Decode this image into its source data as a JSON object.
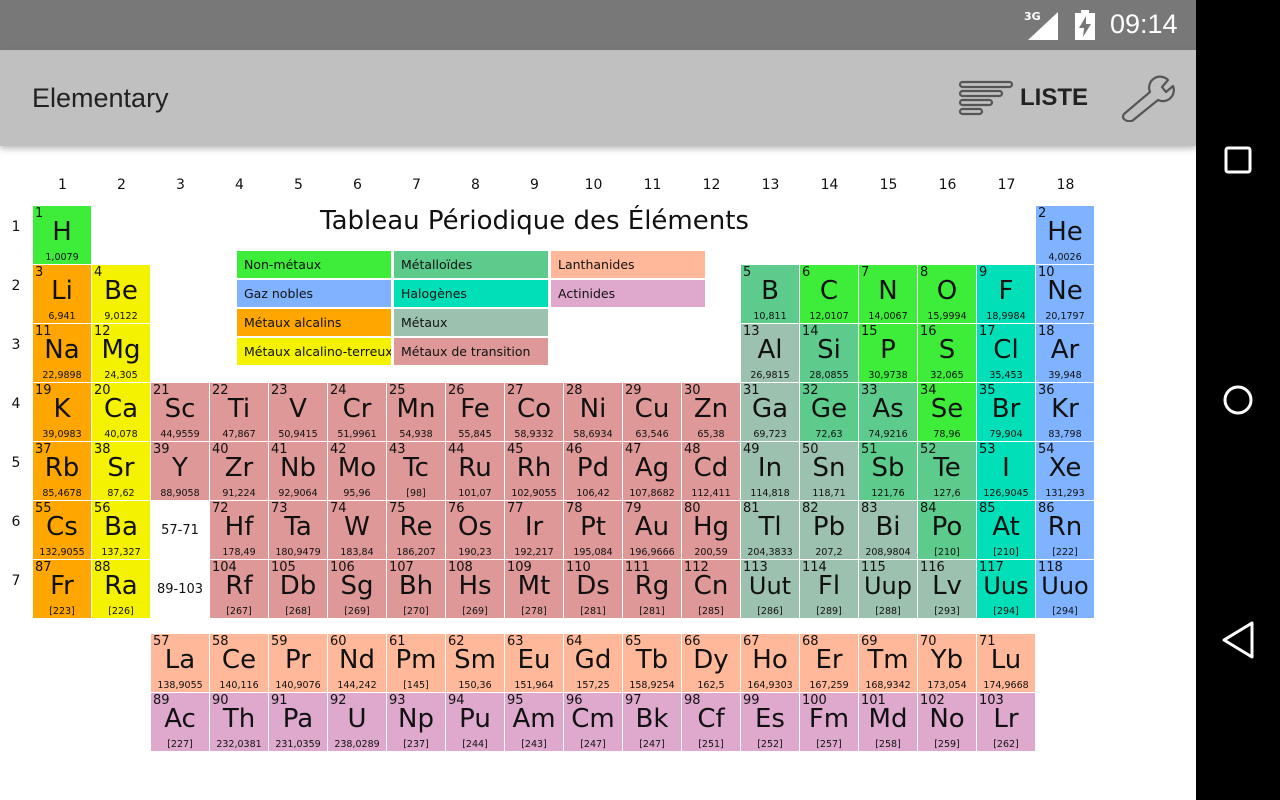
{
  "status_bar": {
    "network": "3G",
    "time": "09:14"
  },
  "app_bar": {
    "title": "Elementary",
    "list_label": "LISTE"
  },
  "table_title": "Tableau Périodique des Éléments",
  "colors": {
    "nonmetal": "#3ded3a",
    "noble": "#7fb2ff",
    "alkali": "#ffa600",
    "alkaline": "#f5f200",
    "metalloid": "#5ccb8c",
    "halogen": "#00dfb8",
    "metal": "#9cc1ae",
    "transition": "#de9898",
    "lanthanide": "#ffb899",
    "actinide": "#dea9cc",
    "appbar": "#c0c0c0",
    "statusbar": "#787878"
  },
  "group_labels": [
    "1",
    "2",
    "3",
    "4",
    "5",
    "6",
    "7",
    "8",
    "9",
    "10",
    "11",
    "12",
    "13",
    "14",
    "15",
    "16",
    "17",
    "18"
  ],
  "period_labels": [
    "1",
    "2",
    "3",
    "4",
    "5",
    "6",
    "7"
  ],
  "legend": [
    {
      "label": "Non-métaux",
      "cat": "nonmetal"
    },
    {
      "label": "Gaz nobles",
      "cat": "noble"
    },
    {
      "label": "Métaux alcalins",
      "cat": "alkali"
    },
    {
      "label": "Métaux alcalino-terreux",
      "cat": "alkaline"
    },
    {
      "label": "Métalloïdes",
      "cat": "metalloid"
    },
    {
      "label": "Halogènes",
      "cat": "halogen"
    },
    {
      "label": "Métaux",
      "cat": "metal"
    },
    {
      "label": "Métaux de transition",
      "cat": "transition"
    },
    {
      "label": "Lanthanides",
      "cat": "lanthanide"
    },
    {
      "label": "Actinides",
      "cat": "actinide"
    }
  ],
  "placeholders": [
    {
      "label": "57-71",
      "row": 6,
      "col": 3
    },
    {
      "label": "89-103",
      "row": 7,
      "col": 3
    }
  ],
  "elements": [
    {
      "n": "1",
      "s": "H",
      "m": "1,0079",
      "cat": "nonmetal",
      "row": 1,
      "col": 1
    },
    {
      "n": "2",
      "s": "He",
      "m": "4,0026",
      "cat": "noble",
      "row": 1,
      "col": 18
    },
    {
      "n": "3",
      "s": "Li",
      "m": "6,941",
      "cat": "alkali",
      "row": 2,
      "col": 1
    },
    {
      "n": "4",
      "s": "Be",
      "m": "9,0122",
      "cat": "alkaline",
      "row": 2,
      "col": 2
    },
    {
      "n": "5",
      "s": "B",
      "m": "10,811",
      "cat": "metalloid",
      "row": 2,
      "col": 13
    },
    {
      "n": "6",
      "s": "C",
      "m": "12,0107",
      "cat": "nonmetal",
      "row": 2,
      "col": 14
    },
    {
      "n": "7",
      "s": "N",
      "m": "14,0067",
      "cat": "nonmetal",
      "row": 2,
      "col": 15
    },
    {
      "n": "8",
      "s": "O",
      "m": "15,9994",
      "cat": "nonmetal",
      "row": 2,
      "col": 16
    },
    {
      "n": "9",
      "s": "F",
      "m": "18,9984",
      "cat": "halogen",
      "row": 2,
      "col": 17
    },
    {
      "n": "10",
      "s": "Ne",
      "m": "20,1797",
      "cat": "noble",
      "row": 2,
      "col": 18
    },
    {
      "n": "11",
      "s": "Na",
      "m": "22,9898",
      "cat": "alkali",
      "row": 3,
      "col": 1
    },
    {
      "n": "12",
      "s": "Mg",
      "m": "24,305",
      "cat": "alkaline",
      "row": 3,
      "col": 2
    },
    {
      "n": "13",
      "s": "Al",
      "m": "26,9815",
      "cat": "metal",
      "row": 3,
      "col": 13
    },
    {
      "n": "14",
      "s": "Si",
      "m": "28,0855",
      "cat": "metalloid",
      "row": 3,
      "col": 14
    },
    {
      "n": "15",
      "s": "P",
      "m": "30,9738",
      "cat": "nonmetal",
      "row": 3,
      "col": 15
    },
    {
      "n": "16",
      "s": "S",
      "m": "32,065",
      "cat": "nonmetal",
      "row": 3,
      "col": 16
    },
    {
      "n": "17",
      "s": "Cl",
      "m": "35,453",
      "cat": "halogen",
      "row": 3,
      "col": 17
    },
    {
      "n": "18",
      "s": "Ar",
      "m": "39,948",
      "cat": "noble",
      "row": 3,
      "col": 18
    },
    {
      "n": "19",
      "s": "K",
      "m": "39,0983",
      "cat": "alkali",
      "row": 4,
      "col": 1
    },
    {
      "n": "20",
      "s": "Ca",
      "m": "40,078",
      "cat": "alkaline",
      "row": 4,
      "col": 2
    },
    {
      "n": "21",
      "s": "Sc",
      "m": "44,9559",
      "cat": "transition",
      "row": 4,
      "col": 3
    },
    {
      "n": "22",
      "s": "Ti",
      "m": "47,867",
      "cat": "transition",
      "row": 4,
      "col": 4
    },
    {
      "n": "23",
      "s": "V",
      "m": "50,9415",
      "cat": "transition",
      "row": 4,
      "col": 5
    },
    {
      "n": "24",
      "s": "Cr",
      "m": "51,9961",
      "cat": "transition",
      "row": 4,
      "col": 6
    },
    {
      "n": "25",
      "s": "Mn",
      "m": "54,938",
      "cat": "transition",
      "row": 4,
      "col": 7
    },
    {
      "n": "26",
      "s": "Fe",
      "m": "55,845",
      "cat": "transition",
      "row": 4,
      "col": 8
    },
    {
      "n": "27",
      "s": "Co",
      "m": "58,9332",
      "cat": "transition",
      "row": 4,
      "col": 9
    },
    {
      "n": "28",
      "s": "Ni",
      "m": "58,6934",
      "cat": "transition",
      "row": 4,
      "col": 10
    },
    {
      "n": "29",
      "s": "Cu",
      "m": "63,546",
      "cat": "transition",
      "row": 4,
      "col": 11
    },
    {
      "n": "30",
      "s": "Zn",
      "m": "65,38",
      "cat": "transition",
      "row": 4,
      "col": 12
    },
    {
      "n": "31",
      "s": "Ga",
      "m": "69,723",
      "cat": "metal",
      "row": 4,
      "col": 13
    },
    {
      "n": "32",
      "s": "Ge",
      "m": "72,63",
      "cat": "metalloid",
      "row": 4,
      "col": 14
    },
    {
      "n": "33",
      "s": "As",
      "m": "74,9216",
      "cat": "metalloid",
      "row": 4,
      "col": 15
    },
    {
      "n": "34",
      "s": "Se",
      "m": "78,96",
      "cat": "nonmetal",
      "row": 4,
      "col": 16
    },
    {
      "n": "35",
      "s": "Br",
      "m": "79,904",
      "cat": "halogen",
      "row": 4,
      "col": 17
    },
    {
      "n": "36",
      "s": "Kr",
      "m": "83,798",
      "cat": "noble",
      "row": 4,
      "col": 18
    },
    {
      "n": "37",
      "s": "Rb",
      "m": "85,4678",
      "cat": "alkali",
      "row": 5,
      "col": 1
    },
    {
      "n": "38",
      "s": "Sr",
      "m": "87,62",
      "cat": "alkaline",
      "row": 5,
      "col": 2
    },
    {
      "n": "39",
      "s": "Y",
      "m": "88,9058",
      "cat": "transition",
      "row": 5,
      "col": 3
    },
    {
      "n": "40",
      "s": "Zr",
      "m": "91,224",
      "cat": "transition",
      "row": 5,
      "col": 4
    },
    {
      "n": "41",
      "s": "Nb",
      "m": "92,9064",
      "cat": "transition",
      "row": 5,
      "col": 5
    },
    {
      "n": "42",
      "s": "Mo",
      "m": "95,96",
      "cat": "transition",
      "row": 5,
      "col": 6
    },
    {
      "n": "43",
      "s": "Tc",
      "m": "[98]",
      "cat": "transition",
      "row": 5,
      "col": 7
    },
    {
      "n": "44",
      "s": "Ru",
      "m": "101,07",
      "cat": "transition",
      "row": 5,
      "col": 8
    },
    {
      "n": "45",
      "s": "Rh",
      "m": "102,9055",
      "cat": "transition",
      "row": 5,
      "col": 9
    },
    {
      "n": "46",
      "s": "Pd",
      "m": "106,42",
      "cat": "transition",
      "row": 5,
      "col": 10
    },
    {
      "n": "47",
      "s": "Ag",
      "m": "107,8682",
      "cat": "transition",
      "row": 5,
      "col": 11
    },
    {
      "n": "48",
      "s": "Cd",
      "m": "112,411",
      "cat": "transition",
      "row": 5,
      "col": 12
    },
    {
      "n": "49",
      "s": "In",
      "m": "114,818",
      "cat": "metal",
      "row": 5,
      "col": 13
    },
    {
      "n": "50",
      "s": "Sn",
      "m": "118,71",
      "cat": "metal",
      "row": 5,
      "col": 14
    },
    {
      "n": "51",
      "s": "Sb",
      "m": "121,76",
      "cat": "metalloid",
      "row": 5,
      "col": 15
    },
    {
      "n": "52",
      "s": "Te",
      "m": "127,6",
      "cat": "metalloid",
      "row": 5,
      "col": 16
    },
    {
      "n": "53",
      "s": "I",
      "m": "126,9045",
      "cat": "halogen",
      "row": 5,
      "col": 17
    },
    {
      "n": "54",
      "s": "Xe",
      "m": "131,293",
      "cat": "noble",
      "row": 5,
      "col": 18
    },
    {
      "n": "55",
      "s": "Cs",
      "m": "132,9055",
      "cat": "alkali",
      "row": 6,
      "col": 1
    },
    {
      "n": "56",
      "s": "Ba",
      "m": "137,327",
      "cat": "alkaline",
      "row": 6,
      "col": 2
    },
    {
      "n": "72",
      "s": "Hf",
      "m": "178,49",
      "cat": "transition",
      "row": 6,
      "col": 4
    },
    {
      "n": "73",
      "s": "Ta",
      "m": "180,9479",
      "cat": "transition",
      "row": 6,
      "col": 5
    },
    {
      "n": "74",
      "s": "W",
      "m": "183,84",
      "cat": "transition",
      "row": 6,
      "col": 6
    },
    {
      "n": "75",
      "s": "Re",
      "m": "186,207",
      "cat": "transition",
      "row": 6,
      "col": 7
    },
    {
      "n": "76",
      "s": "Os",
      "m": "190,23",
      "cat": "transition",
      "row": 6,
      "col": 8
    },
    {
      "n": "77",
      "s": "Ir",
      "m": "192,217",
      "cat": "transition",
      "row": 6,
      "col": 9
    },
    {
      "n": "78",
      "s": "Pt",
      "m": "195,084",
      "cat": "transition",
      "row": 6,
      "col": 10
    },
    {
      "n": "79",
      "s": "Au",
      "m": "196,9666",
      "cat": "transition",
      "row": 6,
      "col": 11
    },
    {
      "n": "80",
      "s": "Hg",
      "m": "200,59",
      "cat": "transition",
      "row": 6,
      "col": 12
    },
    {
      "n": "81",
      "s": "Tl",
      "m": "204,3833",
      "cat": "metal",
      "row": 6,
      "col": 13
    },
    {
      "n": "82",
      "s": "Pb",
      "m": "207,2",
      "cat": "metal",
      "row": 6,
      "col": 14
    },
    {
      "n": "83",
      "s": "Bi",
      "m": "208,9804",
      "cat": "metal",
      "row": 6,
      "col": 15
    },
    {
      "n": "84",
      "s": "Po",
      "m": "[210]",
      "cat": "metalloid",
      "row": 6,
      "col": 16
    },
    {
      "n": "85",
      "s": "At",
      "m": "[210]",
      "cat": "halogen",
      "row": 6,
      "col": 17
    },
    {
      "n": "86",
      "s": "Rn",
      "m": "[222]",
      "cat": "noble",
      "row": 6,
      "col": 18
    },
    {
      "n": "87",
      "s": "Fr",
      "m": "[223]",
      "cat": "alkali",
      "row": 7,
      "col": 1
    },
    {
      "n": "88",
      "s": "Ra",
      "m": "[226]",
      "cat": "alkaline",
      "row": 7,
      "col": 2
    },
    {
      "n": "104",
      "s": "Rf",
      "m": "[267]",
      "cat": "transition",
      "row": 7,
      "col": 4
    },
    {
      "n": "105",
      "s": "Db",
      "m": "[268]",
      "cat": "transition",
      "row": 7,
      "col": 5
    },
    {
      "n": "106",
      "s": "Sg",
      "m": "[269]",
      "cat": "transition",
      "row": 7,
      "col": 6
    },
    {
      "n": "107",
      "s": "Bh",
      "m": "[270]",
      "cat": "transition",
      "row": 7,
      "col": 7
    },
    {
      "n": "108",
      "s": "Hs",
      "m": "[269]",
      "cat": "transition",
      "row": 7,
      "col": 8
    },
    {
      "n": "109",
      "s": "Mt",
      "m": "[278]",
      "cat": "transition",
      "row": 7,
      "col": 9
    },
    {
      "n": "110",
      "s": "Ds",
      "m": "[281]",
      "cat": "transition",
      "row": 7,
      "col": 10
    },
    {
      "n": "111",
      "s": "Rg",
      "m": "[281]",
      "cat": "transition",
      "row": 7,
      "col": 11
    },
    {
      "n": "112",
      "s": "Cn",
      "m": "[285]",
      "cat": "transition",
      "row": 7,
      "col": 12
    },
    {
      "n": "113",
      "s": "Uut",
      "m": "[286]",
      "cat": "metal",
      "row": 7,
      "col": 13
    },
    {
      "n": "114",
      "s": "Fl",
      "m": "[289]",
      "cat": "metal",
      "row": 7,
      "col": 14
    },
    {
      "n": "115",
      "s": "Uup",
      "m": "[288]",
      "cat": "metal",
      "row": 7,
      "col": 15
    },
    {
      "n": "116",
      "s": "Lv",
      "m": "[293]",
      "cat": "metal",
      "row": 7,
      "col": 16
    },
    {
      "n": "117",
      "s": "Uus",
      "m": "[294]",
      "cat": "halogen",
      "row": 7,
      "col": 17
    },
    {
      "n": "118",
      "s": "Uuo",
      "m": "[294]",
      "cat": "noble",
      "row": 7,
      "col": 18
    },
    {
      "n": "57",
      "s": "La",
      "m": "138,9055",
      "cat": "lanthanide",
      "row": 9,
      "col": 3
    },
    {
      "n": "58",
      "s": "Ce",
      "m": "140,116",
      "cat": "lanthanide",
      "row": 9,
      "col": 4
    },
    {
      "n": "59",
      "s": "Pr",
      "m": "140,9076",
      "cat": "lanthanide",
      "row": 9,
      "col": 5
    },
    {
      "n": "60",
      "s": "Nd",
      "m": "144,242",
      "cat": "lanthanide",
      "row": 9,
      "col": 6
    },
    {
      "n": "61",
      "s": "Pm",
      "m": "[145]",
      "cat": "lanthanide",
      "row": 9,
      "col": 7
    },
    {
      "n": "62",
      "s": "Sm",
      "m": "150,36",
      "cat": "lanthanide",
      "row": 9,
      "col": 8
    },
    {
      "n": "63",
      "s": "Eu",
      "m": "151,964",
      "cat": "lanthanide",
      "row": 9,
      "col": 9
    },
    {
      "n": "64",
      "s": "Gd",
      "m": "157,25",
      "cat": "lanthanide",
      "row": 9,
      "col": 10
    },
    {
      "n": "65",
      "s": "Tb",
      "m": "158,9254",
      "cat": "lanthanide",
      "row": 9,
      "col": 11
    },
    {
      "n": "66",
      "s": "Dy",
      "m": "162,5",
      "cat": "lanthanide",
      "row": 9,
      "col": 12
    },
    {
      "n": "67",
      "s": "Ho",
      "m": "164,9303",
      "cat": "lanthanide",
      "row": 9,
      "col": 13
    },
    {
      "n": "68",
      "s": "Er",
      "m": "167,259",
      "cat": "lanthanide",
      "row": 9,
      "col": 14
    },
    {
      "n": "69",
      "s": "Tm",
      "m": "168,9342",
      "cat": "lanthanide",
      "row": 9,
      "col": 15
    },
    {
      "n": "70",
      "s": "Yb",
      "m": "173,054",
      "cat": "lanthanide",
      "row": 9,
      "col": 16
    },
    {
      "n": "71",
      "s": "Lu",
      "m": "174,9668",
      "cat": "lanthanide",
      "row": 9,
      "col": 17
    },
    {
      "n": "89",
      "s": "Ac",
      "m": "[227]",
      "cat": "actinide",
      "row": 10,
      "col": 3
    },
    {
      "n": "90",
      "s": "Th",
      "m": "232,0381",
      "cat": "actinide",
      "row": 10,
      "col": 4
    },
    {
      "n": "91",
      "s": "Pa",
      "m": "231,0359",
      "cat": "actinide",
      "row": 10,
      "col": 5
    },
    {
      "n": "92",
      "s": "U",
      "m": "238,0289",
      "cat": "actinide",
      "row": 10,
      "col": 6
    },
    {
      "n": "93",
      "s": "Np",
      "m": "[237]",
      "cat": "actinide",
      "row": 10,
      "col": 7
    },
    {
      "n": "94",
      "s": "Pu",
      "m": "[244]",
      "cat": "actinide",
      "row": 10,
      "col": 8
    },
    {
      "n": "95",
      "s": "Am",
      "m": "[243]",
      "cat": "actinide",
      "row": 10,
      "col": 9
    },
    {
      "n": "96",
      "s": "Cm",
      "m": "[247]",
      "cat": "actinide",
      "row": 10,
      "col": 10
    },
    {
      "n": "97",
      "s": "Bk",
      "m": "[247]",
      "cat": "actinide",
      "row": 10,
      "col": 11
    },
    {
      "n": "98",
      "s": "Cf",
      "m": "[251]",
      "cat": "actinide",
      "row": 10,
      "col": 12
    },
    {
      "n": "99",
      "s": "Es",
      "m": "[252]",
      "cat": "actinide",
      "row": 10,
      "col": 13
    },
    {
      "n": "100",
      "s": "Fm",
      "m": "[257]",
      "cat": "actinide",
      "row": 10,
      "col": 14
    },
    {
      "n": "101",
      "s": "Md",
      "m": "[258]",
      "cat": "actinide",
      "row": 10,
      "col": 15
    },
    {
      "n": "102",
      "s": "No",
      "m": "[259]",
      "cat": "actinide",
      "row": 10,
      "col": 16
    },
    {
      "n": "103",
      "s": "Lr",
      "m": "[262]",
      "cat": "actinide",
      "row": 10,
      "col": 17
    }
  ]
}
